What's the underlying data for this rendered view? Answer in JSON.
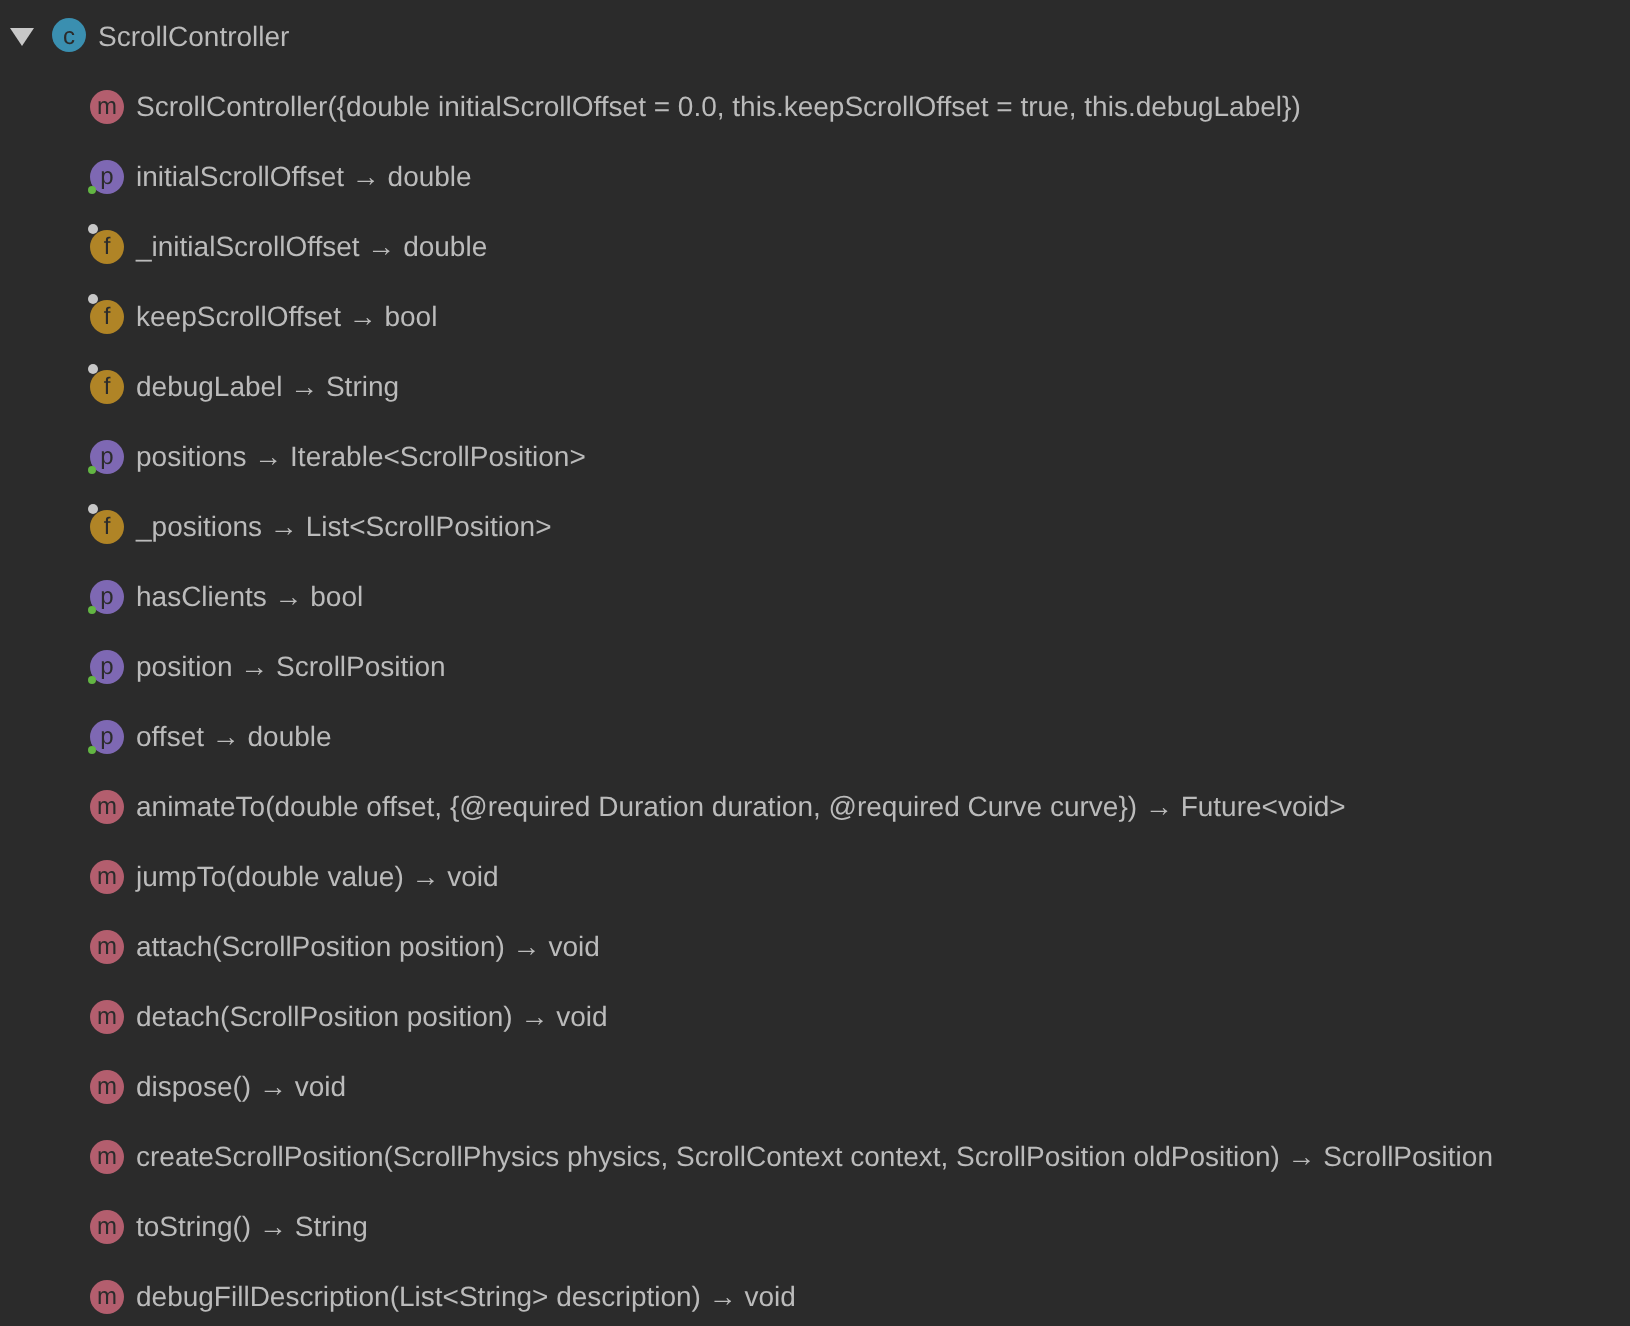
{
  "tree": {
    "label": "ScrollController",
    "kind": "class",
    "badge": "c",
    "expanded": true,
    "children": [
      {
        "kind": "method",
        "badge": "m",
        "label": "ScrollController({double initialScrollOffset = 0.0, this.keepScrollOffset = true, this.debugLabel})"
      },
      {
        "kind": "property",
        "badge": "p",
        "label": "initialScrollOffset → double"
      },
      {
        "kind": "field",
        "badge": "f",
        "label": "_initialScrollOffset → double"
      },
      {
        "kind": "field",
        "badge": "f",
        "label": "keepScrollOffset → bool"
      },
      {
        "kind": "field",
        "badge": "f",
        "label": "debugLabel → String"
      },
      {
        "kind": "property",
        "badge": "p",
        "label": "positions → Iterable<ScrollPosition>"
      },
      {
        "kind": "field",
        "badge": "f",
        "label": "_positions → List<ScrollPosition>"
      },
      {
        "kind": "property",
        "badge": "p",
        "label": "hasClients → bool"
      },
      {
        "kind": "property",
        "badge": "p",
        "label": "position → ScrollPosition"
      },
      {
        "kind": "property",
        "badge": "p",
        "label": "offset → double"
      },
      {
        "kind": "method",
        "badge": "m",
        "label": "animateTo(double offset, {@required Duration duration, @required Curve curve}) → Future<void>"
      },
      {
        "kind": "method",
        "badge": "m",
        "label": "jumpTo(double value) → void"
      },
      {
        "kind": "method",
        "badge": "m",
        "label": "attach(ScrollPosition position) → void"
      },
      {
        "kind": "method",
        "badge": "m",
        "label": "detach(ScrollPosition position) → void"
      },
      {
        "kind": "method",
        "badge": "m",
        "label": "dispose() → void"
      },
      {
        "kind": "method",
        "badge": "m",
        "label": "createScrollPosition(ScrollPhysics physics, ScrollContext context, ScrollPosition oldPosition) → ScrollPosition"
      },
      {
        "kind": "method",
        "badge": "m",
        "label": "toString() → String"
      },
      {
        "kind": "method",
        "badge": "m",
        "label": "debugFillDescription(List<String> description) → void"
      }
    ]
  }
}
